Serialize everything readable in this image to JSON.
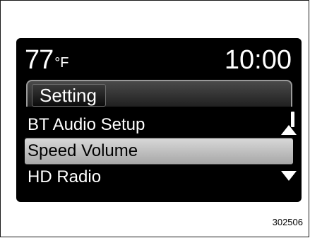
{
  "status_bar": {
    "temperature_value": "77",
    "temperature_unit": "°F",
    "time": "10:00"
  },
  "menu": {
    "title": "Setting",
    "items": [
      {
        "label": "BT Audio Setup",
        "selected": false
      },
      {
        "label": "Speed Volume",
        "selected": true
      },
      {
        "label": "HD Radio",
        "selected": false
      }
    ],
    "scroll_up_icon": "triangle-up-icon",
    "scroll_down_icon": "triangle-down-icon"
  },
  "figure_number": "302506",
  "colors": {
    "screen_background": "#000000",
    "selected_row": "#c4c4c4",
    "text": "#ffffff"
  }
}
